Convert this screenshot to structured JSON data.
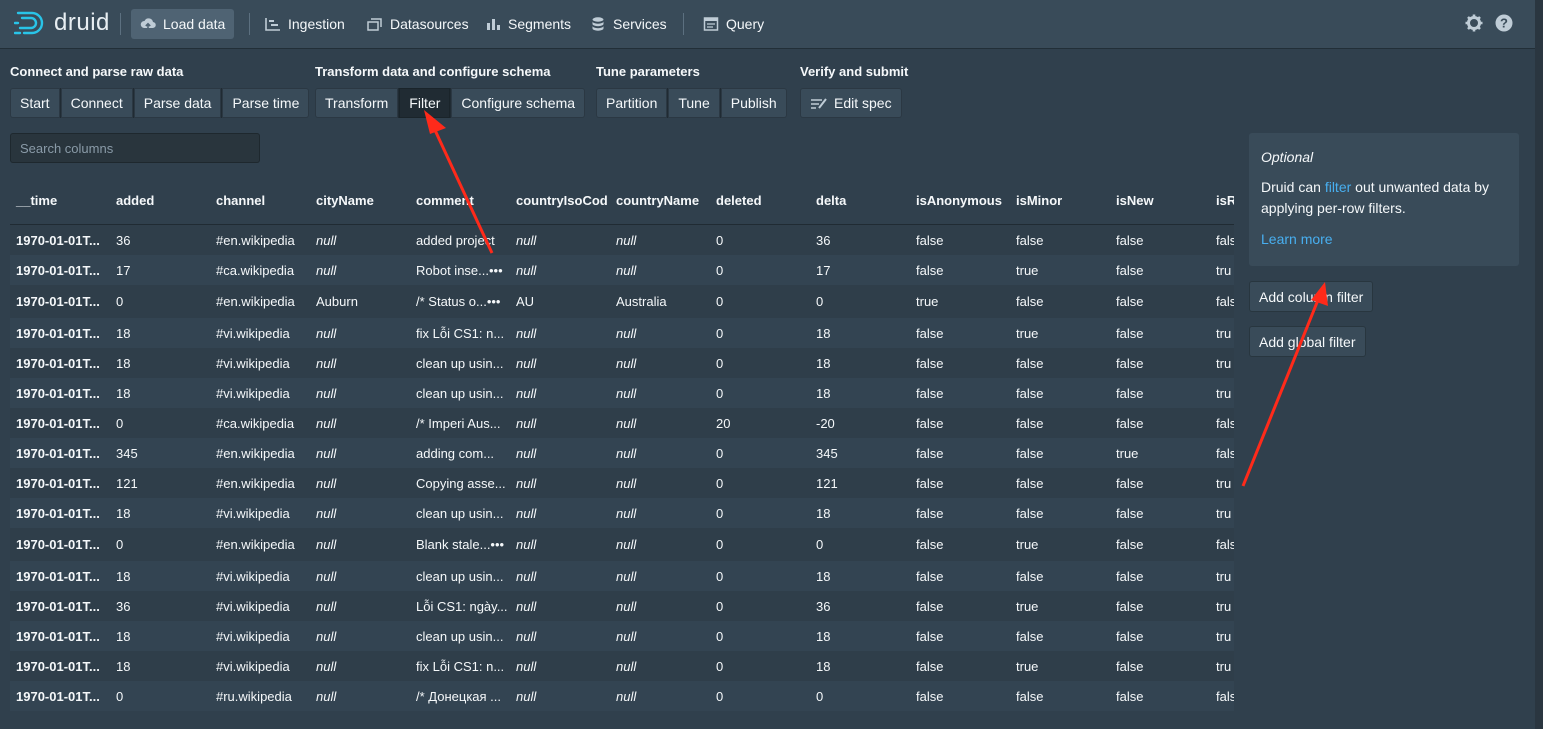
{
  "app": {
    "name": "druid"
  },
  "nav": {
    "items": [
      {
        "label": "Load data",
        "icon": "cloud-upload-icon",
        "active": true
      },
      {
        "label": "Ingestion",
        "icon": "gantt-chart-icon"
      },
      {
        "label": "Datasources",
        "icon": "multi-select-icon"
      },
      {
        "label": "Segments",
        "icon": "stacked-chart-icon"
      },
      {
        "label": "Services",
        "icon": "database-icon"
      },
      {
        "label": "Query",
        "icon": "application-icon"
      }
    ],
    "right_icons": [
      "gear-icon",
      "help-icon"
    ]
  },
  "steps": [
    {
      "title": "Connect and parse raw data",
      "buttons": [
        "Start",
        "Connect",
        "Parse data",
        "Parse time"
      ]
    },
    {
      "title": "Transform data and configure schema",
      "buttons": [
        "Transform",
        "Filter",
        "Configure schema"
      ],
      "active": "Filter"
    },
    {
      "title": "Tune parameters",
      "buttons": [
        "Partition",
        "Tune",
        "Publish"
      ]
    },
    {
      "title": "Verify and submit",
      "buttons": [
        "Edit spec"
      ]
    }
  ],
  "search": {
    "placeholder": "Search columns"
  },
  "table": {
    "columns": [
      "__time",
      "added",
      "channel",
      "cityName",
      "comment",
      "countryIsoCod",
      "countryName",
      "deleted",
      "delta",
      "isAnonymous",
      "isMinor",
      "isNew",
      "isR"
    ],
    "rows": [
      [
        "1970-01-01T...",
        "36",
        "#en.wikipedia",
        "null",
        "added project",
        "null",
        "null",
        "0",
        "36",
        "false",
        "false",
        "false",
        "fals"
      ],
      [
        "1970-01-01T...",
        "17",
        "#ca.wikipedia",
        "null",
        "Robot inse...•••",
        "null",
        "null",
        "0",
        "17",
        "false",
        "true",
        "false",
        "tru"
      ],
      [
        "1970-01-01T...",
        "0",
        "#en.wikipedia",
        "Auburn",
        "/* Status o...•••",
        "AU",
        "Australia",
        "0",
        "0",
        "true",
        "false",
        "false",
        "fals"
      ],
      [
        "1970-01-01T...",
        "18",
        "#vi.wikipedia",
        "null",
        "fix Lỗi CS1: n...",
        "null",
        "null",
        "0",
        "18",
        "false",
        "true",
        "false",
        "tru"
      ],
      [
        "1970-01-01T...",
        "18",
        "#vi.wikipedia",
        "null",
        "clean up usin...",
        "null",
        "null",
        "0",
        "18",
        "false",
        "false",
        "false",
        "tru"
      ],
      [
        "1970-01-01T...",
        "18",
        "#vi.wikipedia",
        "null",
        "clean up usin...",
        "null",
        "null",
        "0",
        "18",
        "false",
        "false",
        "false",
        "tru"
      ],
      [
        "1970-01-01T...",
        "0",
        "#ca.wikipedia",
        "null",
        "/* Imperi Aus...",
        "null",
        "null",
        "20",
        "-20",
        "false",
        "false",
        "false",
        "fals"
      ],
      [
        "1970-01-01T...",
        "345",
        "#en.wikipedia",
        "null",
        "adding com...",
        "null",
        "null",
        "0",
        "345",
        "false",
        "false",
        "true",
        "fals"
      ],
      [
        "1970-01-01T...",
        "121",
        "#en.wikipedia",
        "null",
        "Copying asse...",
        "null",
        "null",
        "0",
        "121",
        "false",
        "false",
        "false",
        "tru"
      ],
      [
        "1970-01-01T...",
        "18",
        "#vi.wikipedia",
        "null",
        "clean up usin...",
        "null",
        "null",
        "0",
        "18",
        "false",
        "false",
        "false",
        "tru"
      ],
      [
        "1970-01-01T...",
        "0",
        "#en.wikipedia",
        "null",
        "Blank stale...•••",
        "null",
        "null",
        "0",
        "0",
        "false",
        "true",
        "false",
        "fals"
      ],
      [
        "1970-01-01T...",
        "18",
        "#vi.wikipedia",
        "null",
        "clean up usin...",
        "null",
        "null",
        "0",
        "18",
        "false",
        "false",
        "false",
        "tru"
      ],
      [
        "1970-01-01T...",
        "36",
        "#vi.wikipedia",
        "null",
        "Lỗi CS1: ngày...",
        "null",
        "null",
        "0",
        "36",
        "false",
        "true",
        "false",
        "tru"
      ],
      [
        "1970-01-01T...",
        "18",
        "#vi.wikipedia",
        "null",
        "clean up usin...",
        "null",
        "null",
        "0",
        "18",
        "false",
        "false",
        "false",
        "tru"
      ],
      [
        "1970-01-01T...",
        "18",
        "#vi.wikipedia",
        "null",
        "fix Lỗi CS1: n...",
        "null",
        "null",
        "0",
        "18",
        "false",
        "true",
        "false",
        "tru"
      ],
      [
        "1970-01-01T...",
        "0",
        "#ru.wikipedia",
        "null",
        "/* Донецкая ...",
        "null",
        "null",
        "0",
        "0",
        "false",
        "false",
        "false",
        "fals"
      ]
    ]
  },
  "info": {
    "optional": "Optional",
    "text_before": "Druid can ",
    "link": "filter",
    "text_after": " out unwanted data by applying per-row filters.",
    "learn_more": "Learn more"
  },
  "actions": {
    "add_column_filter": "Add column filter",
    "add_global_filter": "Add global filter"
  },
  "colors": {
    "accent_link": "#48aff0",
    "annotation_arrow": "#ff2a1a"
  }
}
